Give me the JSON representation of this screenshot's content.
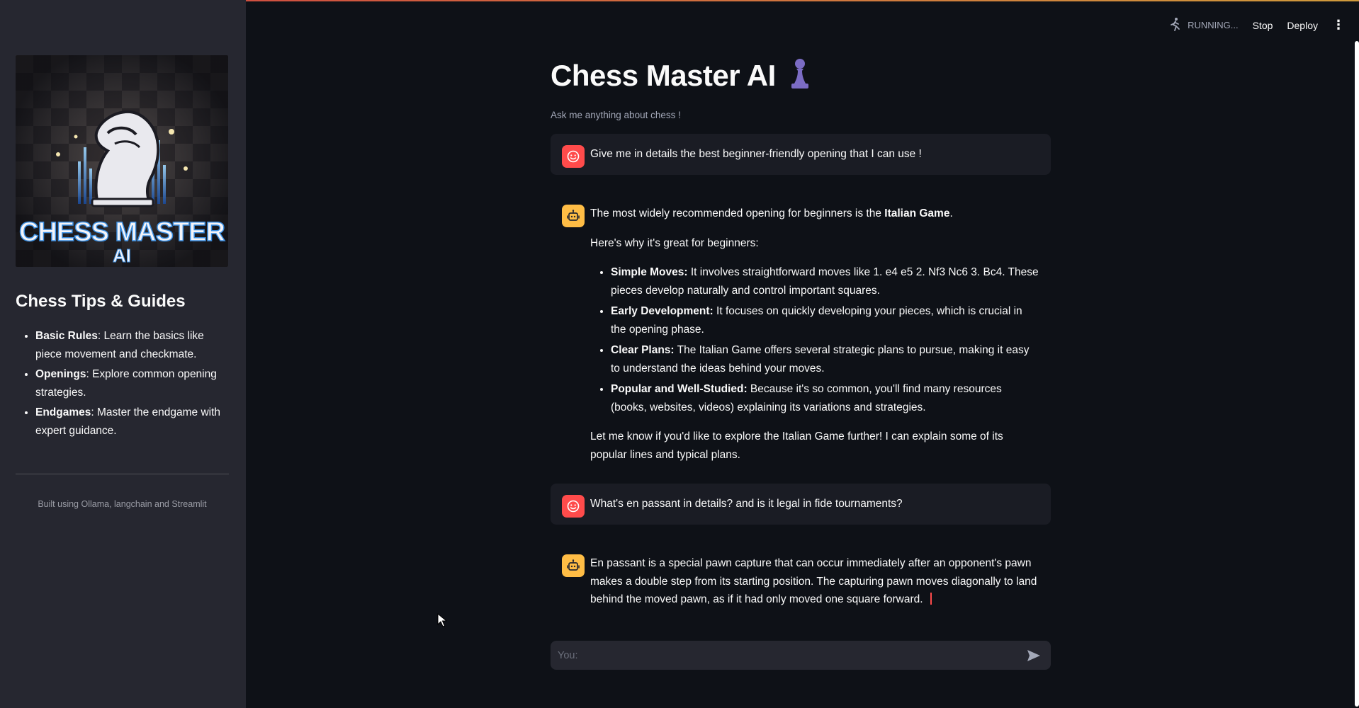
{
  "colors": {
    "background": "#0e1117",
    "sidebar": "#262730",
    "user_avatar": "#ff4b4b",
    "bot_avatar": "#ffbd45",
    "pawn": "#7b6cc4"
  },
  "header": {
    "status": "RUNNING...",
    "stop_label": "Stop",
    "deploy_label": "Deploy",
    "menu_icon": "kebab-menu-icon",
    "status_icon": "running-figure-icon"
  },
  "sidebar": {
    "logo": {
      "line1": "CHESS MASTER",
      "line2": "AI"
    },
    "heading": "Chess Tips & Guides",
    "items": [
      {
        "bold": "Basic Rules",
        "text": ": Learn the basics like piece movement and checkmate."
      },
      {
        "bold": "Openings",
        "text": ": Explore common opening strategies."
      },
      {
        "bold": "Endgames",
        "text": ": Master the endgame with expert guidance."
      }
    ],
    "footer": "Built using Ollama, langchain and Streamlit"
  },
  "main": {
    "title": "Chess Master AI",
    "title_icon": "chess-pawn-icon",
    "subtitle": "Ask me anything about chess !",
    "messages": [
      {
        "role": "user",
        "text": "Give me in details the best beginner-friendly opening that I can use !"
      },
      {
        "role": "assistant",
        "intro": "The most widely recommended opening for beginners is the ",
        "intro_bold": "Italian Game",
        "intro_end": ".",
        "para": "Here's why it's great for beginners:",
        "bullets": [
          {
            "bold": "Simple Moves:",
            "text": " It involves straightforward moves like 1. e4 e5 2. Nf3 Nc6 3. Bc4. These pieces develop naturally and control important squares."
          },
          {
            "bold": "Early Development:",
            "text": " It focuses on quickly developing your pieces, which is crucial in the opening phase."
          },
          {
            "bold": "Clear Plans:",
            "text": " The Italian Game offers several strategic plans to pursue, making it easy to understand the ideas behind your moves."
          },
          {
            "bold": "Popular and Well-Studied:",
            "text": " Because it's so common, you'll find many resources (books, websites, videos) explaining its variations and strategies."
          }
        ],
        "closing": "Let me know if you'd like to explore the Italian Game further! I can explain some of its popular lines and typical plans."
      },
      {
        "role": "user",
        "text": "What's en passant in details? and is it legal in fide tournaments?"
      },
      {
        "role": "assistant",
        "text": "En passant is a special pawn capture that can occur immediately after an opponent's pawn makes a double step from its starting position. The capturing pawn moves diagonally to land behind the moved pawn, as if it had only moved one square forward."
      }
    ]
  },
  "chat_input": {
    "placeholder": "You:",
    "send_icon": "send-arrow-icon"
  }
}
